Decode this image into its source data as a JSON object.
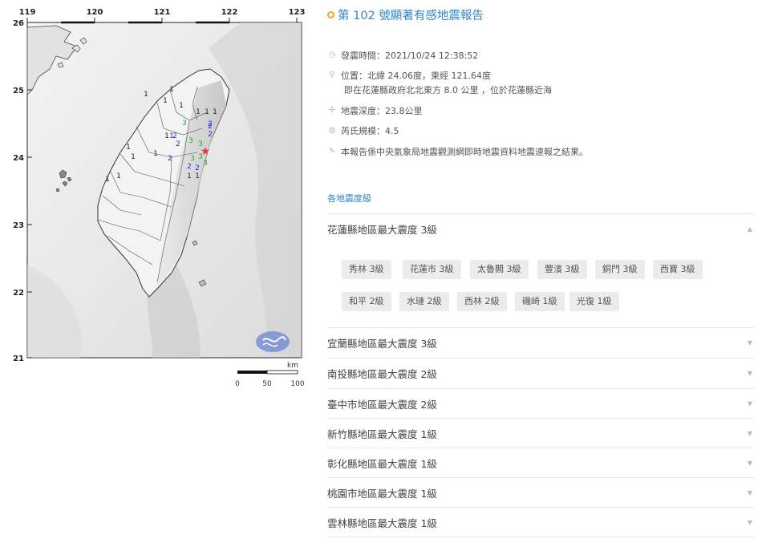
{
  "map": {
    "lon_labels": [
      "119",
      "120",
      "121",
      "122",
      "123"
    ],
    "lat_labels": [
      "26",
      "25",
      "24",
      "23",
      "22",
      "21"
    ],
    "scale_unit": "km",
    "scale_labels": [
      "0",
      "50",
      "100"
    ],
    "station_marks": [
      {
        "v": "1",
        "color": "#222"
      },
      {
        "v": "1",
        "color": "#222"
      },
      {
        "v": "1",
        "color": "#222"
      },
      {
        "v": "1",
        "color": "#222"
      },
      {
        "v": "1",
        "color": "#222"
      },
      {
        "v": "1",
        "color": "#222"
      },
      {
        "v": "1",
        "color": "#222"
      },
      {
        "v": "1",
        "color": "#222"
      },
      {
        "v": "1",
        "color": "#222"
      },
      {
        "v": "1",
        "color": "#222"
      },
      {
        "v": "1",
        "color": "#222"
      },
      {
        "v": "1",
        "color": "#222"
      },
      {
        "v": "1",
        "color": "#222"
      },
      {
        "v": "1",
        "color": "#222"
      },
      {
        "v": "1",
        "color": "#222"
      },
      {
        "v": "2",
        "color": "#2233cc"
      },
      {
        "v": "2",
        "color": "#2233cc"
      },
      {
        "v": "2",
        "color": "#2233cc"
      },
      {
        "v": "2",
        "color": "#2233cc"
      },
      {
        "v": "2",
        "color": "#2233cc"
      },
      {
        "v": "2",
        "color": "#2233cc"
      },
      {
        "v": "2",
        "color": "#2233cc"
      },
      {
        "v": "2",
        "color": "#2233cc"
      },
      {
        "v": "3",
        "color": "#22aa22"
      },
      {
        "v": "3",
        "color": "#22aa22"
      },
      {
        "v": "3",
        "color": "#22aa22"
      },
      {
        "v": "3",
        "color": "#22aa22"
      },
      {
        "v": "3",
        "color": "#22aa22"
      },
      {
        "v": "3",
        "color": "#22aa22"
      },
      {
        "v": "1",
        "color": "#2233cc"
      }
    ],
    "epicenter_color": "#e53935"
  },
  "report": {
    "title": "第 102 號顯著有感地震報告",
    "time": "發震時間：2021/10/24 12:38:52",
    "location": "位置：北緯 24.06度，東經 121.64度",
    "location_detail": "即在花蓮縣政府北北東方 8.0 公里 ，位於花蓮縣近海",
    "depth": "地震深度：23.8公里",
    "magnitude": "芮氏規模：4.5",
    "note": "本報告係中央氣象局地震觀測網即時地震資料地震速報之結果。",
    "section_label": "各地震度級",
    "accent_color": "#2f86c9",
    "regions": [
      "花蓮縣地區最大震度 3級",
      "宜蘭縣地區最大震度 3級",
      "南投縣地區最大震度 2級",
      "臺中市地區最大震度 2級",
      "新竹縣地區最大震度 1級",
      "彰化縣地區最大震度 1級",
      "桃園市地區最大震度 1級",
      "雲林縣地區最大震度 1級"
    ],
    "hualien_stations": [
      "秀林 3級",
      "花蓮市 3級",
      "太魯閣 3級",
      "豐濱 3級",
      "銅門 3級",
      "西寶 3級",
      "和平 2級",
      "水璉 2級",
      "西林 2級",
      "磯崎 1級",
      "光復 1級"
    ]
  }
}
